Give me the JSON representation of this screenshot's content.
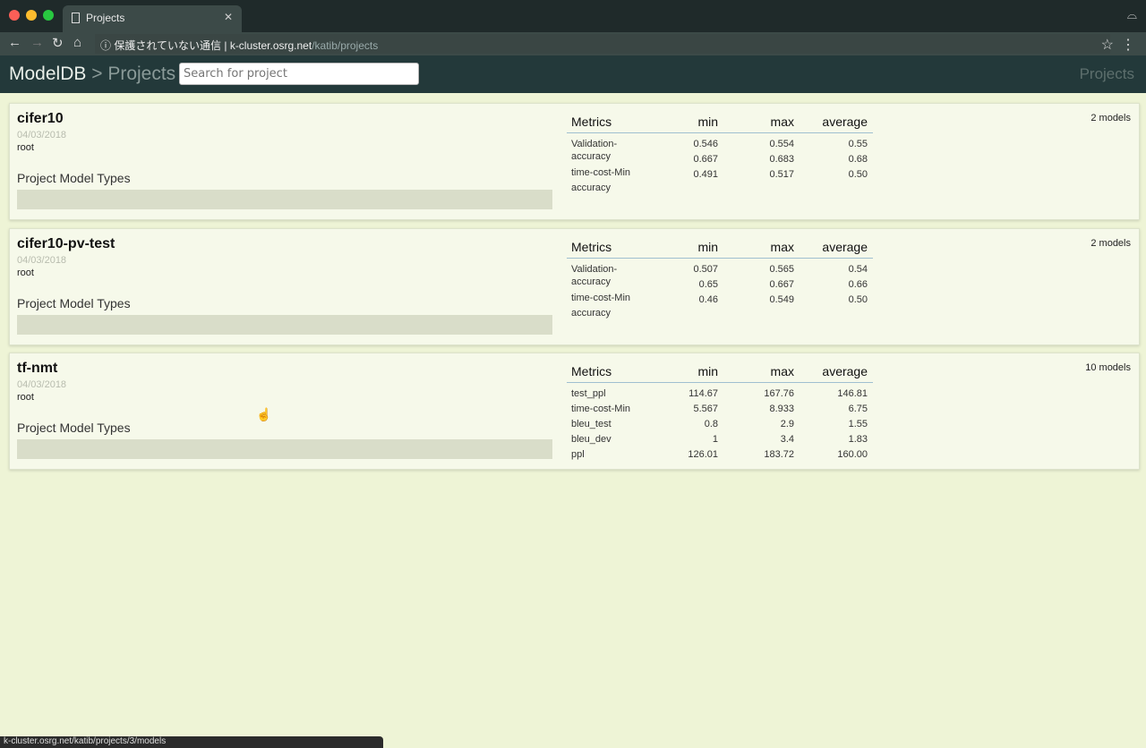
{
  "browser": {
    "tab_title": "Projects",
    "security_label": "保護されていない通信",
    "url_host": "k-cluster.osrg.net",
    "url_path": "/katib/projects",
    "status_url": "k-cluster.osrg.net/katib/projects/3/models"
  },
  "header": {
    "brand": "ModelDB",
    "separator": " > ",
    "section": "Projects",
    "search_placeholder": "Search for project",
    "nav_link": "Projects"
  },
  "metric_headers": {
    "name": "Metrics",
    "min": "min",
    "max": "max",
    "avg": "average"
  },
  "projects": [
    {
      "name": "cifer10",
      "date": "04/03/2018",
      "owner": "root",
      "model_types_label": "Project Model Types",
      "count": "2 models",
      "labels": [
        "Validation-accuracy",
        "time-cost-Min accuracy"
      ],
      "rows": [
        [
          "0.546",
          "0.554",
          "0.55"
        ],
        [
          "0.667",
          "0.683",
          "0.68"
        ],
        [
          "0.491",
          "0.517",
          "0.50"
        ]
      ]
    },
    {
      "name": "cifer10-pv-test",
      "date": "04/03/2018",
      "owner": "root",
      "model_types_label": "Project Model Types",
      "count": "2 models",
      "labels": [
        "Validation-accuracy",
        "time-cost-Min accuracy"
      ],
      "rows": [
        [
          "0.507",
          "0.565",
          "0.54"
        ],
        [
          "0.65",
          "0.667",
          "0.66"
        ],
        [
          "0.46",
          "0.549",
          "0.50"
        ]
      ]
    },
    {
      "name": "tf-nmt",
      "date": "04/03/2018",
      "owner": "root",
      "model_types_label": "Project Model Types",
      "count": "10 models",
      "rows": [
        [
          "test_ppl",
          "114.67",
          "167.76",
          "146.81"
        ],
        [
          "time-cost-Min",
          "5.567",
          "8.933",
          "6.75"
        ],
        [
          "bleu_test",
          "0.8",
          "2.9",
          "1.55"
        ],
        [
          "bleu_dev",
          "1",
          "3.4",
          "1.83"
        ],
        [
          "ppl",
          "126.01",
          "183.72",
          "160.00"
        ]
      ]
    }
  ]
}
